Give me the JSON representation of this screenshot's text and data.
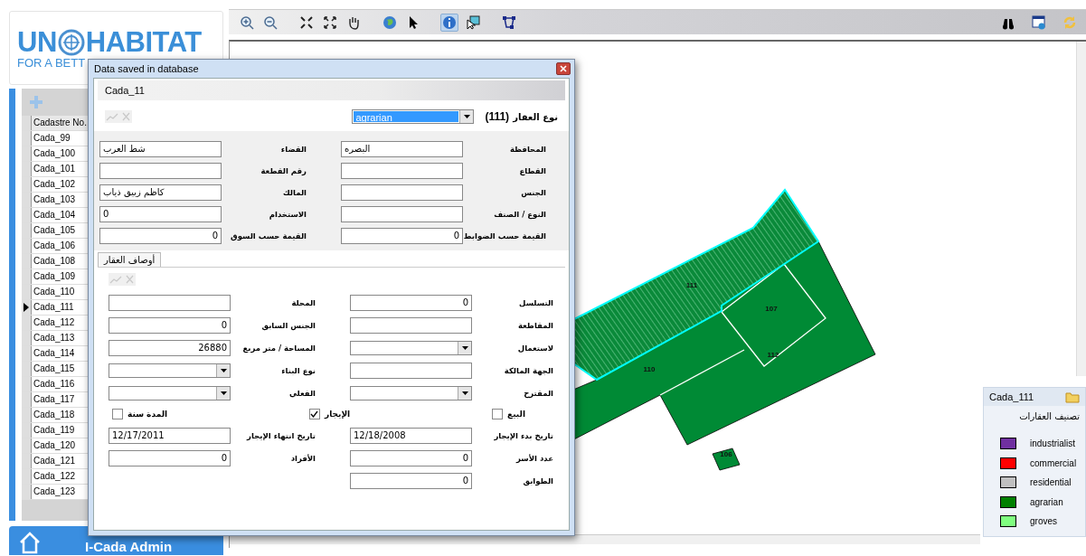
{
  "logo": {
    "name": "UN",
    "name2": "HABITAT",
    "tagline": "FOR A BETT"
  },
  "toolbar": {
    "tools": [
      {
        "selected": false
      },
      {
        "selected": false
      },
      {
        "selected": false
      },
      {
        "selected": false
      },
      {
        "selected": false
      },
      {
        "selected": false
      },
      {
        "selected": false
      },
      {
        "selected": true
      },
      {
        "selected": false
      },
      {
        "selected": false
      }
    ]
  },
  "grid": {
    "column": "Cadastre No.",
    "rows": [
      {
        "label": "Cada_99",
        "selected": false
      },
      {
        "label": "Cada_100",
        "selected": false
      },
      {
        "label": "Cada_101",
        "selected": false
      },
      {
        "label": "Cada_102",
        "selected": false
      },
      {
        "label": "Cada_103",
        "selected": false
      },
      {
        "label": "Cada_104",
        "selected": false
      },
      {
        "label": "Cada_105",
        "selected": false
      },
      {
        "label": "Cada_106",
        "selected": false
      },
      {
        "label": "Cada_108",
        "selected": false
      },
      {
        "label": "Cada_109",
        "selected": false
      },
      {
        "label": "Cada_110",
        "selected": false
      },
      {
        "label": "Cada_111",
        "selected": true
      },
      {
        "label": "Cada_112",
        "selected": false
      },
      {
        "label": "Cada_113",
        "selected": false
      },
      {
        "label": "Cada_114",
        "selected": false
      },
      {
        "label": "Cada_115",
        "selected": false
      },
      {
        "label": "Cada_116",
        "selected": false
      },
      {
        "label": "Cada_117",
        "selected": false
      },
      {
        "label": "Cada_118",
        "selected": false
      },
      {
        "label": "Cada_119",
        "selected": false
      },
      {
        "label": "Cada_120",
        "selected": false
      },
      {
        "label": "Cada_121",
        "selected": false
      },
      {
        "label": "Cada_122",
        "selected": false
      },
      {
        "label": "Cada_123",
        "selected": false
      }
    ]
  },
  "home_button": {
    "label": "I-Cada Admin"
  },
  "map": {
    "parcels": [
      {
        "label": "111"
      },
      {
        "label": "107"
      },
      {
        "label": "112"
      },
      {
        "label": "110"
      },
      {
        "label": "106"
      }
    ]
  },
  "legend": {
    "title": "Cada_111",
    "heading": "تصنيف العقارات",
    "items": [
      {
        "label": "industrialist",
        "color": "#7030a0"
      },
      {
        "label": "commercial",
        "color": "#ff0000"
      },
      {
        "label": "residential",
        "color": "#c0c0c0"
      },
      {
        "label": "agrarian",
        "color": "#008000"
      },
      {
        "label": "groves",
        "color": "#80ff80"
      }
    ]
  },
  "dialog": {
    "title": "Data saved in database",
    "header": "Cada_11",
    "type_number": "(111)",
    "type_label": "نوع العقار",
    "type_value": "agrarian",
    "fields": [
      [
        {
          "label": "المحافظة",
          "value": "البصره",
          "kind": "text"
        },
        {
          "label": "القضاء",
          "value": "شط العرب",
          "kind": "text"
        }
      ],
      [
        {
          "label": "القطاع",
          "kind": "text"
        },
        {
          "label": "رقم القطعة",
          "kind": "text"
        }
      ],
      [
        {
          "label": "الجنس",
          "kind": "text"
        },
        {
          "label": "المالك",
          "value": "كاظم زبيق ذياب",
          "kind": "text"
        }
      ],
      [
        {
          "label": "النوع / الصنف",
          "kind": "text"
        },
        {
          "label": "الاستخدام",
          "value": "0",
          "kind": "text"
        }
      ],
      [
        {
          "label": "القيمة حسب الضوابط",
          "value": "0",
          "kind": "number"
        },
        {
          "label": "القيمة حسب السوق",
          "value": "0",
          "kind": "number"
        }
      ]
    ],
    "tab": "أوصاف العقار",
    "details": [
      [
        {
          "label": "التسلسل",
          "value": "0",
          "kind": "number"
        },
        {
          "label": "المحلة",
          "kind": "text"
        }
      ],
      [
        {
          "label": "المقاطعة",
          "kind": "text"
        },
        {
          "label": "الجنس السابق",
          "value": "0",
          "kind": "number"
        }
      ],
      [
        {
          "label": "لاستعمال",
          "kind": "select"
        },
        {
          "label": "المساحة / متر مربع",
          "value": "26880",
          "kind": "number"
        }
      ],
      [
        {
          "label": "الجهة المالكة",
          "kind": "text"
        },
        {
          "label": "نوع البناء",
          "kind": "select"
        }
      ],
      [
        {
          "label": "المقترح",
          "kind": "select"
        },
        {
          "label": "الفعلي",
          "kind": "select"
        }
      ]
    ],
    "checks": [
      {
        "label": "البيع",
        "checked": false
      },
      {
        "label": "الإيجار",
        "checked": true
      },
      {
        "label": "المدة سنة",
        "checked": false
      }
    ],
    "more": [
      [
        {
          "label": "تاريخ بدء الإيجار",
          "value": "12/18/2008",
          "kind": "text"
        },
        {
          "label": "تاريخ انتهاء الإيجار",
          "value": "12/17/2011",
          "kind": "text"
        }
      ],
      [
        {
          "label": "عدد الأسر",
          "value": "0",
          "kind": "number"
        },
        {
          "label": "الأفراد",
          "value": "0",
          "kind": "number"
        }
      ],
      [
        {
          "label": "الطوابق",
          "value": "0",
          "kind": "number"
        }
      ]
    ]
  }
}
